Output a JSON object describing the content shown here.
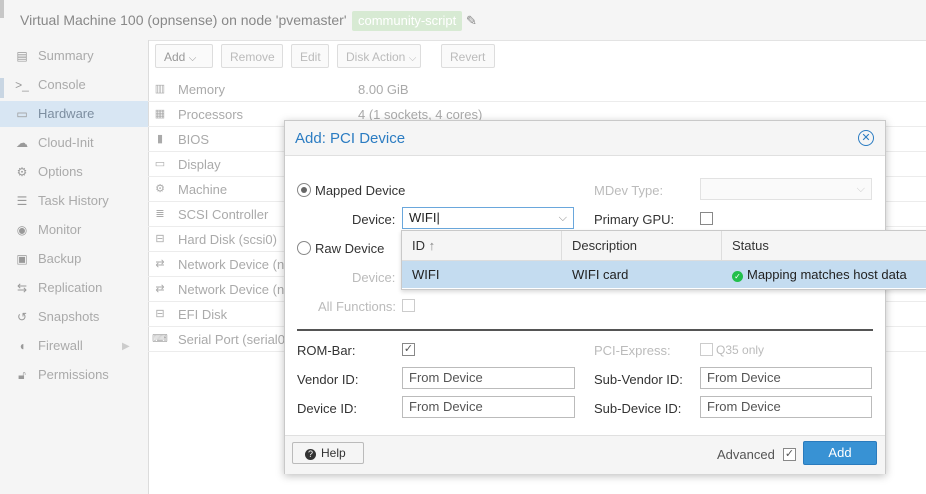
{
  "header": {
    "title": "Virtual Machine 100 (opnsense) on node 'pvemaster'",
    "tag": "community-script"
  },
  "nav": {
    "items": [
      {
        "label": "Summary",
        "icon": "book-icon"
      },
      {
        "label": "Console",
        "icon": "terminal-icon"
      },
      {
        "label": "Hardware",
        "icon": "monitor-icon"
      },
      {
        "label": "Cloud-Init",
        "icon": "cloud-icon"
      },
      {
        "label": "Options",
        "icon": "gear-icon"
      },
      {
        "label": "Task History",
        "icon": "list-icon"
      },
      {
        "label": "Monitor",
        "icon": "eye-icon"
      },
      {
        "label": "Backup",
        "icon": "floppy-icon"
      },
      {
        "label": "Replication",
        "icon": "retweet-icon"
      },
      {
        "label": "Snapshots",
        "icon": "history-icon"
      },
      {
        "label": "Firewall",
        "icon": "shield-icon"
      },
      {
        "label": "Permissions",
        "icon": "unlock-icon"
      }
    ]
  },
  "toolbar": {
    "add": "Add",
    "remove": "Remove",
    "edit": "Edit",
    "disk_action": "Disk Action",
    "revert": "Revert"
  },
  "hardware": {
    "rows": [
      {
        "name": "Memory",
        "value": "8.00 GiB"
      },
      {
        "name": "Processors",
        "value": "4 (1 sockets, 4 cores)"
      },
      {
        "name": "BIOS",
        "value": ""
      },
      {
        "name": "Display",
        "value": ""
      },
      {
        "name": "Machine",
        "value": ""
      },
      {
        "name": "SCSI Controller",
        "value": ""
      },
      {
        "name": "Hard Disk (scsi0)",
        "value": ""
      },
      {
        "name": "Network Device (n",
        "value": ""
      },
      {
        "name": "Network Device (n",
        "value": ""
      },
      {
        "name": "EFI Disk",
        "value": ""
      },
      {
        "name": "Serial Port (serial0",
        "value": ""
      }
    ]
  },
  "dialog": {
    "title": "Add: PCI Device",
    "mapped_device": "Mapped Device",
    "device_label": "Device:",
    "device_value": "WIFI",
    "mdev_type": "MDev Type:",
    "primary_gpu": "Primary GPU:",
    "raw_device": "Raw Device",
    "raw_device_label": "Device:",
    "all_functions": "All Functions:",
    "rom_bar": "ROM-Bar:",
    "pci_express": "PCI-Express:",
    "q35_only": "Q35 only",
    "vendor_id": "Vendor ID:",
    "vendor_id_placeholder": "From Device",
    "device_id": "Device ID:",
    "device_id_placeholder": "From Device",
    "sub_vendor_id": "Sub-Vendor ID:",
    "sub_vendor_id_placeholder": "From Device",
    "sub_device_id": "Sub-Device ID:",
    "sub_device_id_placeholder": "From Device",
    "help": "Help",
    "advanced": "Advanced",
    "add": "Add"
  },
  "dropdown": {
    "columns": [
      "ID",
      "Description",
      "Status"
    ],
    "rows": [
      {
        "id": "WIFI",
        "description": "WIFI card",
        "status": "Mapping matches host data"
      }
    ]
  }
}
